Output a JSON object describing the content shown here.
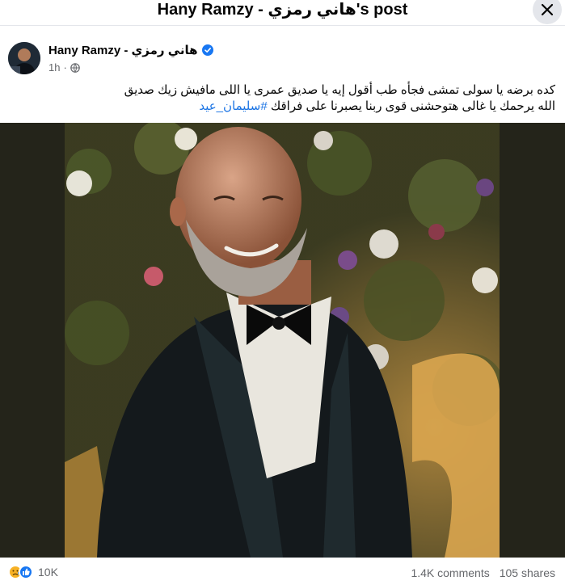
{
  "dialog": {
    "title": "Hany Ramzy - هاني رمزي's post",
    "close_icon": "close-icon"
  },
  "post": {
    "author": "Hany Ramzy - هاني رمزي",
    "verified_icon": "verified-badge-icon",
    "time": "1h",
    "audience_icon": "globe-icon",
    "text_line1": "كده برضه يا سولى تمشى فجأه طب أقول إيه يا صديق عمرى يا اللى مافيش زيك صديق",
    "text_line2_prefix": "الله يرحمك يا غالى هتوحشنى قوى ربنا يصبرنا على فراقك  ",
    "hashtag": "#سليمان_عيد"
  },
  "stats": {
    "reaction_icons": [
      "sad-reaction-icon",
      "like-reaction-icon"
    ],
    "reactions": "10K",
    "comments": "1.4K comments",
    "shares": "105 shares"
  },
  "colors": {
    "link": "#1b74e4",
    "secondary_text": "#65676b",
    "like_blue": "#1877f2",
    "sad_yellow": "#f7b125"
  }
}
